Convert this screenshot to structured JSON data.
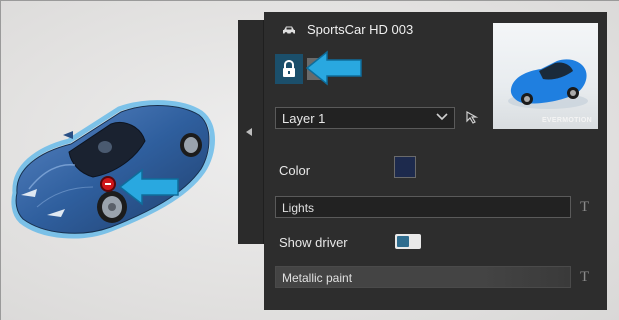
{
  "object": {
    "title": "SportsCar HD 003",
    "layer_selected": "Layer 1",
    "color_label": "Color",
    "color_value": "#1d2a4d",
    "lights_field": "Lights",
    "show_driver_label": "Show driver",
    "show_driver_on": true,
    "paint_field": "Metallic paint",
    "thumbnail_brand": "EVERMOTION"
  },
  "icons": {
    "header": "car-icon",
    "lock": "lock-icon",
    "layer_picker": "cursor-icon",
    "text_type": "text-T-icon"
  },
  "colors": {
    "panel_bg": "#2d2d2d",
    "accent_blue": "#1b4f6b",
    "callout_arrow": "#29a8e0",
    "marker_red": "#d0161b",
    "car_blue": "#2f5f9e"
  }
}
